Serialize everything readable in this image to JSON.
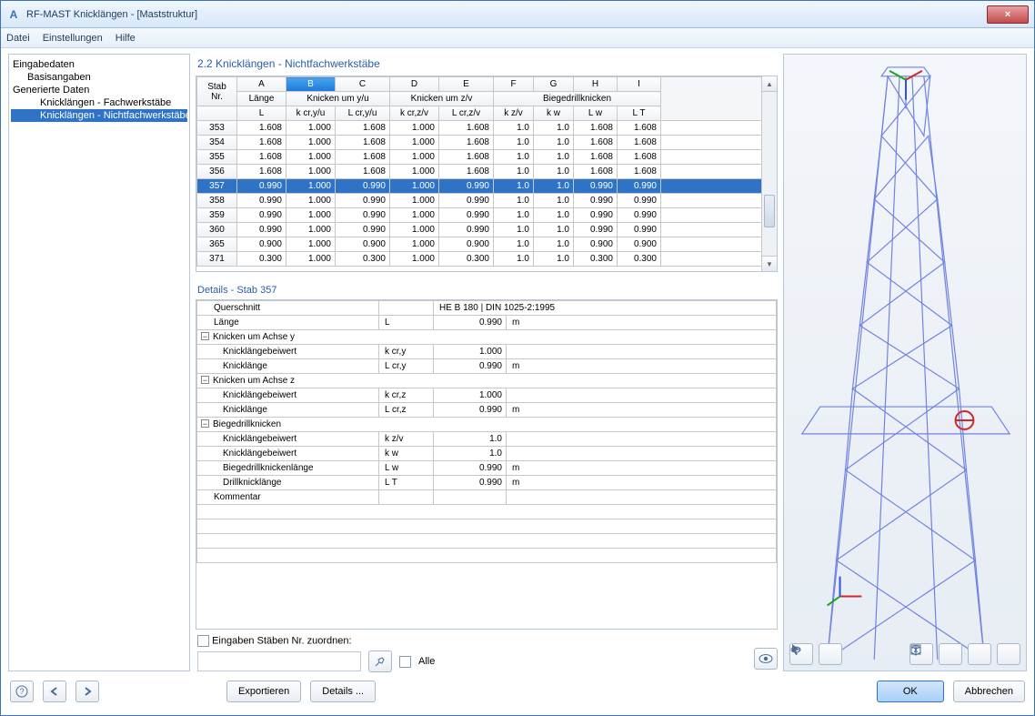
{
  "window": {
    "app_icon_letter": "A",
    "title": "RF-MAST Knicklängen - [Maststruktur]",
    "close": "×"
  },
  "menu": {
    "file": "Datei",
    "settings": "Einstellungen",
    "help": "Hilfe"
  },
  "sidebar": {
    "items": [
      {
        "label": "Eingabedaten",
        "cls": "lvl1"
      },
      {
        "label": "Basisangaben",
        "cls": "lvl2"
      },
      {
        "label": "Generierte Daten",
        "cls": "lvl1"
      },
      {
        "label": "Knicklängen - Fachwerkstäbe",
        "cls": "lvl3"
      },
      {
        "label": "Knicklängen - Nichtfachwerkstäbe",
        "cls": "lvl3 sel"
      }
    ]
  },
  "section_title": "2.2 Knicklängen - Nichtfachwerkstäbe",
  "thead": {
    "r1": {
      "nr": "Stab",
      "a": "A",
      "b": "B",
      "c": "C",
      "d": "D",
      "e": "E",
      "f": "F",
      "g": "G",
      "h": "H",
      "i": "I"
    },
    "r2": {
      "nr": "Nr.",
      "a": "Länge",
      "bc": "Knicken um y/u",
      "de": "Knicken um z/v",
      "fghi": "Biegedrillknicken"
    },
    "r3": {
      "a": "L",
      "b": "k cr,y/u",
      "c": "L cr,y/u",
      "d": "k cr,z/v",
      "e": "L cr,z/v",
      "f": "k z/v",
      "g": "k w",
      "h": "L w",
      "i": "L T"
    }
  },
  "rows": [
    {
      "nr": "353",
      "a": "1.608",
      "b": "1.000",
      "c": "1.608",
      "d": "1.000",
      "e": "1.608",
      "f": "1.0",
      "g": "1.0",
      "h": "1.608",
      "i": "1.608"
    },
    {
      "nr": "354",
      "a": "1.608",
      "b": "1.000",
      "c": "1.608",
      "d": "1.000",
      "e": "1.608",
      "f": "1.0",
      "g": "1.0",
      "h": "1.608",
      "i": "1.608"
    },
    {
      "nr": "355",
      "a": "1.608",
      "b": "1.000",
      "c": "1.608",
      "d": "1.000",
      "e": "1.608",
      "f": "1.0",
      "g": "1.0",
      "h": "1.608",
      "i": "1.608"
    },
    {
      "nr": "356",
      "a": "1.608",
      "b": "1.000",
      "c": "1.608",
      "d": "1.000",
      "e": "1.608",
      "f": "1.0",
      "g": "1.0",
      "h": "1.608",
      "i": "1.608"
    },
    {
      "nr": "357",
      "a": "0.990",
      "b": "1.000",
      "c": "0.990",
      "d": "1.000",
      "e": "0.990",
      "f": "1.0",
      "g": "1.0",
      "h": "0.990",
      "i": "0.990",
      "sel": true
    },
    {
      "nr": "358",
      "a": "0.990",
      "b": "1.000",
      "c": "0.990",
      "d": "1.000",
      "e": "0.990",
      "f": "1.0",
      "g": "1.0",
      "h": "0.990",
      "i": "0.990"
    },
    {
      "nr": "359",
      "a": "0.990",
      "b": "1.000",
      "c": "0.990",
      "d": "1.000",
      "e": "0.990",
      "f": "1.0",
      "g": "1.0",
      "h": "0.990",
      "i": "0.990"
    },
    {
      "nr": "360",
      "a": "0.990",
      "b": "1.000",
      "c": "0.990",
      "d": "1.000",
      "e": "0.990",
      "f": "1.0",
      "g": "1.0",
      "h": "0.990",
      "i": "0.990"
    },
    {
      "nr": "365",
      "a": "0.900",
      "b": "1.000",
      "c": "0.900",
      "d": "1.000",
      "e": "0.900",
      "f": "1.0",
      "g": "1.0",
      "h": "0.900",
      "i": "0.900"
    },
    {
      "nr": "371",
      "a": "0.300",
      "b": "1.000",
      "c": "0.300",
      "d": "1.000",
      "e": "0.300",
      "f": "1.0",
      "g": "1.0",
      "h": "0.300",
      "i": "0.300"
    }
  ],
  "details_title": "Details  -  Stab 357",
  "details": {
    "querschnitt_label": "Querschnitt",
    "querschnitt_val": "HE B 180 | DIN 1025-2:1995",
    "laenge_label": "Länge",
    "laenge_sym": "L",
    "laenge_val": "0.990",
    "laenge_unit": "m",
    "gy": "Knicken um Achse y",
    "kcry_label": "Knicklängebeiwert",
    "kcry_sym": "k cr,y",
    "kcry_val": "1.000",
    "lcry_label": "Knicklänge",
    "lcry_sym": "L cr,y",
    "lcry_val": "0.990",
    "lcry_unit": "m",
    "gz": "Knicken um Achse z",
    "kcrz_label": "Knicklängebeiwert",
    "kcrz_sym": "k cr,z",
    "kcrz_val": "1.000",
    "lcrz_label": "Knicklänge",
    "lcrz_sym": "L cr,z",
    "lcrz_val": "0.990",
    "lcrz_unit": "m",
    "gb": "Biegedrillknicken",
    "kzv_label": "Knicklängebeiwert",
    "kzv_sym": "k z/v",
    "kzv_val": "1.0",
    "kw_label": "Knicklängebeiwert",
    "kw_sym": "k w",
    "kw_val": "1.0",
    "lw_label": "Biegedrillknickenlänge",
    "lw_sym": "L w",
    "lw_val": "0.990",
    "lw_unit": "m",
    "lt_label": "Drillknicklänge",
    "lt_sym": "L T",
    "lt_val": "0.990",
    "lt_unit": "m",
    "kommentar": "Kommentar"
  },
  "assign_label": "Eingaben Stäben Nr. zuordnen:",
  "alle_label": "Alle",
  "footer": {
    "export": "Exportieren",
    "details": "Details ...",
    "ok": "OK",
    "cancel": "Abbrechen"
  }
}
